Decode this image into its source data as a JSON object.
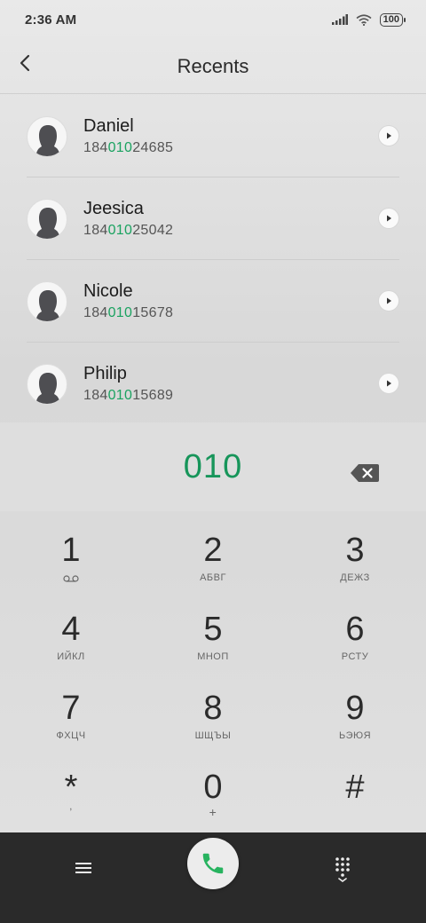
{
  "status": {
    "time": "2:36 AM",
    "battery": "100"
  },
  "header": {
    "title": "Recents"
  },
  "contacts": [
    {
      "name": "Daniel",
      "number_pre": "184",
      "number_match": "010",
      "number_post": "24685"
    },
    {
      "name": "Jeesica",
      "number_pre": "184",
      "number_match": "010",
      "number_post": "25042"
    },
    {
      "name": "Nicole",
      "number_pre": "184",
      "number_match": "010",
      "number_post": "15678"
    },
    {
      "name": "Philip",
      "number_pre": "184",
      "number_match": "010",
      "number_post": "15689"
    }
  ],
  "dialer": {
    "input": "010"
  },
  "keypad": [
    {
      "digit": "1",
      "letters": ""
    },
    {
      "digit": "2",
      "letters": "АБВГ"
    },
    {
      "digit": "3",
      "letters": "ДЕЖЗ"
    },
    {
      "digit": "4",
      "letters": "ИЙКЛ"
    },
    {
      "digit": "5",
      "letters": "МНОП"
    },
    {
      "digit": "6",
      "letters": "РСТУ"
    },
    {
      "digit": "7",
      "letters": "ФХЦЧ"
    },
    {
      "digit": "8",
      "letters": "ШЩЪЫ"
    },
    {
      "digit": "9",
      "letters": "ЬЭЮЯ"
    },
    {
      "digit": "*",
      "letters": ","
    },
    {
      "digit": "0",
      "letters": "+"
    },
    {
      "digit": "#",
      "letters": ""
    }
  ],
  "colors": {
    "accent": "#1aa260",
    "call_icon": "#27b35f",
    "bottom_bar": "#2a2a2a"
  },
  "icons": {
    "back": "chevron-left-icon",
    "info": "play-arrow-icon",
    "backspace": "backspace-icon",
    "voicemail": "voicemail-icon",
    "menu": "hamburger-menu-icon",
    "call": "phone-icon",
    "dialpad": "dialpad-icon"
  }
}
